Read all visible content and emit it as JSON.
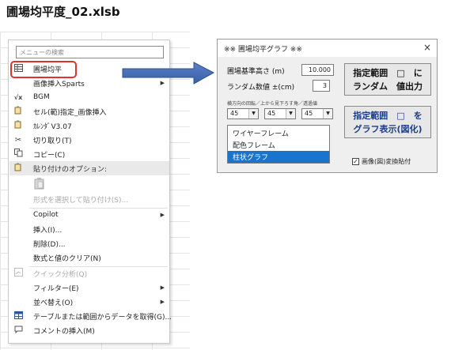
{
  "page_title": "圃場均平度_02.xlsb",
  "context_menu": {
    "search_placeholder": "メニューの検索",
    "items": [
      {
        "icon": "grid-icon",
        "label": "圃場均平"
      },
      {
        "icon": "none",
        "label": "画像挿入Sparts",
        "submenu": true
      },
      {
        "icon": "vba-icon",
        "label": "BGM"
      },
      {
        "icon": "cell-copy-icon",
        "label": "セル(範)指定_画像挿入"
      },
      {
        "icon": "calendar-icon",
        "label": "ｶﾚﾝﾀﾞV3.07"
      },
      {
        "icon": "scissors-icon",
        "label": "切り取り(T)"
      },
      {
        "icon": "copy-icon",
        "label": "コピー(C)"
      },
      {
        "icon": "paste-icon",
        "label": "貼り付けのオプション:"
      },
      {
        "icon": "none",
        "label": "形式を選択して貼り付け(S)..."
      },
      {
        "icon": "none",
        "label": "Copilot",
        "submenu": true
      },
      {
        "icon": "none",
        "label": "挿入(I)..."
      },
      {
        "icon": "none",
        "label": "削除(D)..."
      },
      {
        "icon": "none",
        "label": "数式と値のクリア(N)"
      },
      {
        "icon": "quick-analysis-icon",
        "label": "クイック分析(Q)"
      },
      {
        "icon": "none",
        "label": "フィルター(E)",
        "submenu": true
      },
      {
        "icon": "none",
        "label": "並べ替え(O)",
        "submenu": true
      },
      {
        "icon": "table-icon",
        "label": "テーブルまたは範囲からデータを取得(G)..."
      },
      {
        "icon": "comment-icon",
        "label": "コメントの挿入(M)"
      }
    ]
  },
  "dialog": {
    "title": "※※ 圃場均平グラフ ※※",
    "close_glyph": "×",
    "height_label": "圃場基準高さ (m)",
    "height_value": "10.000",
    "random_label": "ランダム数値 ±(cm)",
    "random_value": "3",
    "angle_note": "横方向の回転／上から見下ろす角／透過値",
    "combo_values": [
      "45",
      "45",
      "45"
    ],
    "list_items": [
      "ワイヤーフレーム",
      "配色フレーム",
      "柱状グラフ"
    ],
    "list_selected": 2,
    "btn_random_line1": "指定範囲　□　に",
    "btn_random_line2": "ランダム　値出力",
    "btn_graph_line1": "指定範囲　□　を",
    "btn_graph_line2": "グラフ表示(図化)",
    "checkbox_label": "画像(図)変換貼付",
    "checkbox_checked": true
  }
}
